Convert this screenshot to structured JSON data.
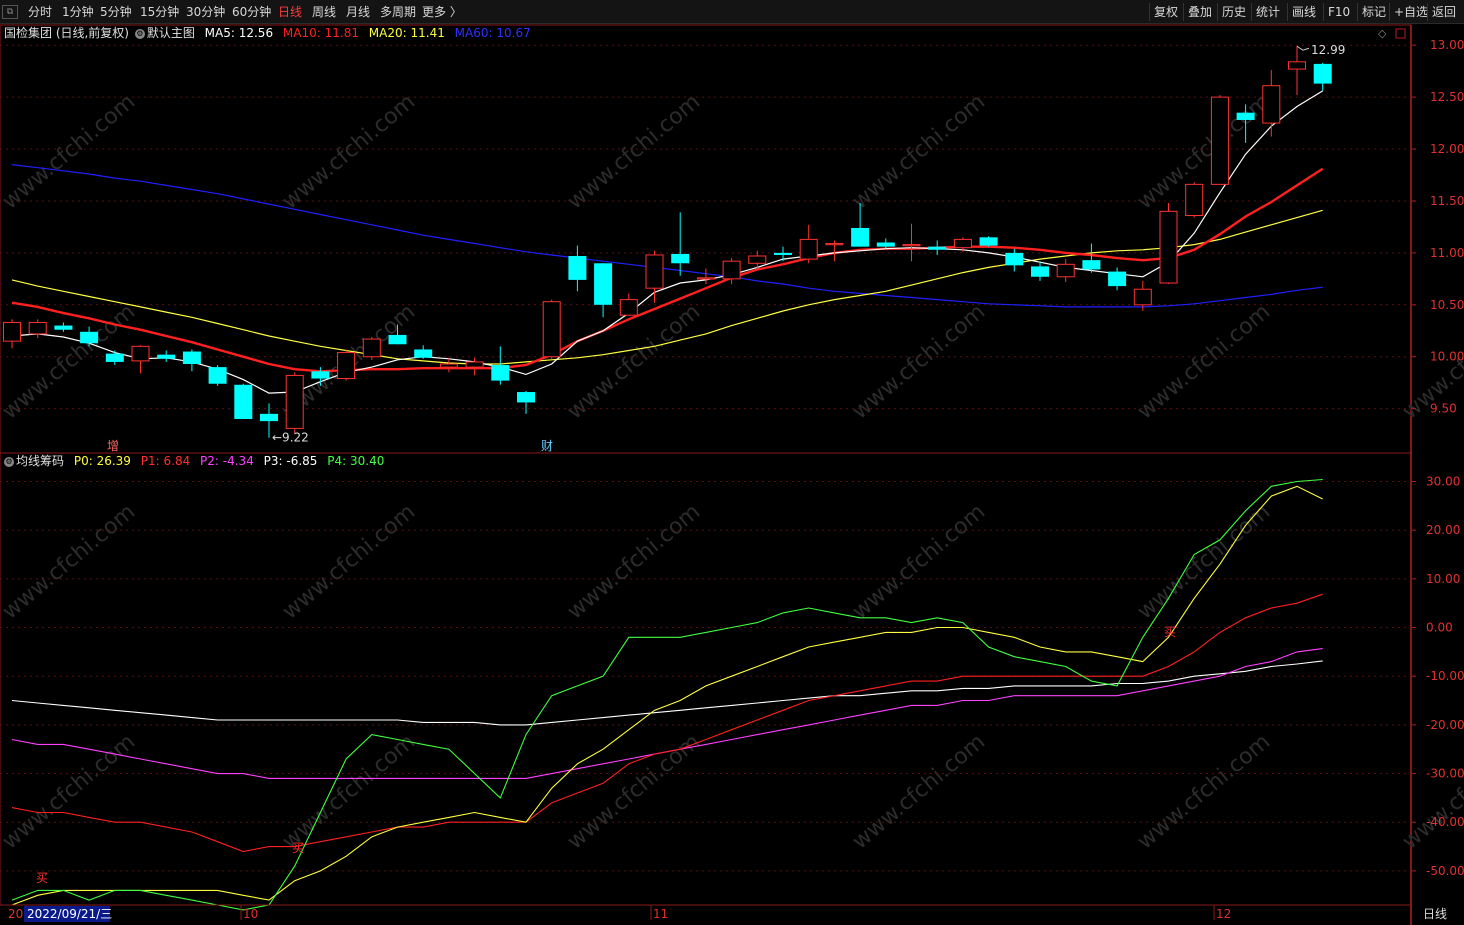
{
  "toolbar": {
    "periods": [
      "分时",
      "1分钟",
      "5分钟",
      "15分钟",
      "30分钟",
      "60分钟",
      "日线",
      "周线",
      "月线",
      "多周期",
      "更多 〉"
    ],
    "active_period": "日线",
    "right": [
      "复权",
      "叠加",
      "历史",
      "统计",
      "画线",
      "F10",
      "标记",
      "+自选",
      "返回"
    ]
  },
  "main_legend": {
    "stock": "国检集团 (日线,前复权)",
    "template": "默认主图",
    "ma5": "MA5: 12.56",
    "ma10": "MA10: 11.81",
    "ma20": "MA20: 11.41",
    "ma60": "MA60: 10.67"
  },
  "indicator_legend": {
    "name": "均线筹码",
    "p0": "P0: 26.39",
    "p1": "P1: 6.84",
    "p2": "P2: -4.34",
    "p3": "P3: -6.85",
    "p4": "P4: 30.40"
  },
  "annotations": {
    "high": "12.99",
    "low": "9.22",
    "mark_zeng": "增",
    "mark_cai": "财",
    "buy": "买"
  },
  "x_axis": {
    "cursor_date": "2022/09/21/三",
    "year_prefix": "20",
    "month_10": "10",
    "month_11": "11",
    "month_12": "12"
  },
  "period_tab": "日线",
  "watermark": "www.cfchi.com",
  "colors": {
    "up": "#ff3232",
    "down": "#00ffff",
    "ma5": "#ffffff",
    "ma10": "#ff2020",
    "ma20": "#ffff40",
    "ma60": "#2020ff",
    "p0": "#ffff40",
    "p1": "#ff2020",
    "p2": "#ff40ff",
    "p3": "#ffffff",
    "p4": "#40ff40"
  },
  "chart_data": [
    {
      "type": "candlestick",
      "title": "国检集团 (日线,前复权)",
      "ylim": [
        9.15,
        13.05
      ],
      "yticks": [
        "13.00",
        "12.50",
        "12.00",
        "11.50",
        "11.00",
        "10.50",
        "10.00",
        "9.50"
      ],
      "candles": [
        {
          "o": 10.15,
          "h": 10.36,
          "l": 10.08,
          "c": 10.33
        },
        {
          "o": 10.22,
          "h": 10.36,
          "l": 10.18,
          "c": 10.33
        },
        {
          "o": 10.3,
          "h": 10.33,
          "l": 10.24,
          "c": 10.26
        },
        {
          "o": 10.24,
          "h": 10.29,
          "l": 10.1,
          "c": 10.13
        },
        {
          "o": 10.03,
          "h": 10.06,
          "l": 9.92,
          "c": 9.95
        },
        {
          "o": 9.96,
          "h": 10.11,
          "l": 9.84,
          "c": 10.1
        },
        {
          "o": 10.02,
          "h": 10.06,
          "l": 9.95,
          "c": 9.98
        },
        {
          "o": 10.05,
          "h": 10.07,
          "l": 9.86,
          "c": 9.93
        },
        {
          "o": 9.9,
          "h": 9.92,
          "l": 9.72,
          "c": 9.74
        },
        {
          "o": 9.73,
          "h": 9.74,
          "l": 9.4,
          "c": 9.4
        },
        {
          "o": 9.45,
          "h": 9.55,
          "l": 9.22,
          "c": 9.38
        },
        {
          "o": 9.31,
          "h": 9.85,
          "l": 9.26,
          "c": 9.82
        },
        {
          "o": 9.86,
          "h": 9.9,
          "l": 9.72,
          "c": 9.79
        },
        {
          "o": 9.79,
          "h": 10.07,
          "l": 9.77,
          "c": 10.04
        },
        {
          "o": 10.0,
          "h": 10.19,
          "l": 9.97,
          "c": 10.17
        },
        {
          "o": 10.21,
          "h": 10.31,
          "l": 10.12,
          "c": 10.12
        },
        {
          "o": 10.07,
          "h": 10.11,
          "l": 9.98,
          "c": 9.99
        },
        {
          "o": 9.9,
          "h": 9.99,
          "l": 9.85,
          "c": 9.93
        },
        {
          "o": 9.9,
          "h": 9.99,
          "l": 9.82,
          "c": 9.95
        },
        {
          "o": 9.92,
          "h": 10.1,
          "l": 9.73,
          "c": 9.77
        },
        {
          "o": 9.66,
          "h": 9.67,
          "l": 9.45,
          "c": 9.56
        },
        {
          "o": 10.0,
          "h": 10.55,
          "l": 9.98,
          "c": 10.53
        },
        {
          "o": 10.97,
          "h": 11.07,
          "l": 10.63,
          "c": 10.74
        },
        {
          "o": 10.9,
          "h": 10.9,
          "l": 10.38,
          "c": 10.5
        },
        {
          "o": 10.4,
          "h": 10.61,
          "l": 10.4,
          "c": 10.55
        },
        {
          "o": 10.66,
          "h": 11.02,
          "l": 10.52,
          "c": 10.98
        },
        {
          "o": 10.99,
          "h": 11.39,
          "l": 10.78,
          "c": 10.9
        },
        {
          "o": 10.75,
          "h": 10.85,
          "l": 10.7,
          "c": 10.76
        },
        {
          "o": 10.75,
          "h": 10.95,
          "l": 10.7,
          "c": 10.92
        },
        {
          "o": 10.9,
          "h": 11.02,
          "l": 10.84,
          "c": 10.97
        },
        {
          "o": 11.0,
          "h": 11.06,
          "l": 10.92,
          "c": 10.98
        },
        {
          "o": 10.94,
          "h": 11.27,
          "l": 10.9,
          "c": 11.13
        },
        {
          "o": 11.08,
          "h": 11.12,
          "l": 10.92,
          "c": 11.09
        },
        {
          "o": 11.24,
          "h": 11.48,
          "l": 11.06,
          "c": 11.06
        },
        {
          "o": 11.1,
          "h": 11.14,
          "l": 11.04,
          "c": 11.06
        },
        {
          "o": 11.07,
          "h": 11.28,
          "l": 10.92,
          "c": 11.08
        },
        {
          "o": 11.06,
          "h": 11.12,
          "l": 10.98,
          "c": 11.03
        },
        {
          "o": 11.05,
          "h": 11.15,
          "l": 11.01,
          "c": 11.13
        },
        {
          "o": 11.15,
          "h": 11.16,
          "l": 11.06,
          "c": 11.07
        },
        {
          "o": 11.0,
          "h": 11.04,
          "l": 10.82,
          "c": 10.88
        },
        {
          "o": 10.87,
          "h": 10.92,
          "l": 10.73,
          "c": 10.77
        },
        {
          "o": 10.77,
          "h": 10.94,
          "l": 10.72,
          "c": 10.89
        },
        {
          "o": 10.93,
          "h": 11.09,
          "l": 10.81,
          "c": 10.84
        },
        {
          "o": 10.82,
          "h": 10.86,
          "l": 10.64,
          "c": 10.68
        },
        {
          "o": 10.5,
          "h": 10.73,
          "l": 10.44,
          "c": 10.65
        },
        {
          "o": 10.71,
          "h": 11.48,
          "l": 10.7,
          "c": 11.4
        },
        {
          "o": 11.36,
          "h": 11.68,
          "l": 11.34,
          "c": 11.66
        },
        {
          "o": 11.66,
          "h": 12.52,
          "l": 11.66,
          "c": 12.5
        },
        {
          "o": 12.35,
          "h": 12.43,
          "l": 12.06,
          "c": 12.28
        },
        {
          "o": 12.25,
          "h": 12.76,
          "l": 12.12,
          "c": 12.61
        },
        {
          "o": 12.77,
          "h": 12.99,
          "l": 12.52,
          "c": 12.84
        },
        {
          "o": 12.82,
          "h": 12.83,
          "l": 12.56,
          "c": 12.63
        }
      ],
      "ma5": [
        10.2,
        10.22,
        10.19,
        10.13,
        10.04,
        9.98,
        9.99,
        9.95,
        9.88,
        9.78,
        9.65,
        9.66,
        9.76,
        9.85,
        9.9,
        9.97,
        10.0,
        9.98,
        9.95,
        9.9,
        9.83,
        9.93,
        10.15,
        10.25,
        10.42,
        10.62,
        10.71,
        10.74,
        10.79,
        10.86,
        10.94,
        10.97,
        11.0,
        11.02,
        11.04,
        11.05,
        11.04,
        11.03,
        11.0,
        10.96,
        10.91,
        10.86,
        10.83,
        10.8,
        10.77,
        10.91,
        11.19,
        11.58,
        11.95,
        12.22,
        12.41,
        12.56
      ],
      "ma10": [
        10.52,
        10.48,
        10.42,
        10.37,
        10.31,
        10.26,
        10.2,
        10.14,
        10.07,
        10.0,
        9.93,
        9.88,
        9.86,
        9.87,
        9.88,
        9.88,
        9.89,
        9.89,
        9.89,
        9.89,
        9.92,
        10.02,
        10.15,
        10.25,
        10.36,
        10.46,
        10.56,
        10.66,
        10.76,
        10.84,
        10.89,
        10.95,
        11.0,
        11.03,
        11.04,
        11.04,
        11.05,
        11.06,
        11.06,
        11.05,
        11.03,
        11.0,
        10.98,
        10.95,
        10.93,
        10.95,
        11.03,
        11.18,
        11.35,
        11.49,
        11.65,
        11.81
      ],
      "ma20": [
        10.74,
        10.68,
        10.63,
        10.58,
        10.53,
        10.48,
        10.43,
        10.38,
        10.32,
        10.26,
        10.2,
        10.15,
        10.1,
        10.06,
        10.02,
        9.98,
        9.96,
        9.94,
        9.93,
        9.93,
        9.95,
        9.97,
        9.99,
        10.02,
        10.06,
        10.1,
        10.16,
        10.22,
        10.3,
        10.37,
        10.44,
        10.5,
        10.55,
        10.59,
        10.63,
        10.69,
        10.75,
        10.81,
        10.86,
        10.9,
        10.94,
        10.97,
        11.0,
        11.02,
        11.03,
        11.05,
        11.08,
        11.13,
        11.2,
        11.27,
        11.34,
        11.41
      ],
      "ma60": [
        11.85,
        11.82,
        11.79,
        11.76,
        11.72,
        11.69,
        11.65,
        11.61,
        11.57,
        11.52,
        11.47,
        11.42,
        11.37,
        11.32,
        11.27,
        11.22,
        11.17,
        11.13,
        11.09,
        11.05,
        11.01,
        10.98,
        10.95,
        10.92,
        10.89,
        10.86,
        10.83,
        10.8,
        10.77,
        10.73,
        10.7,
        10.66,
        10.63,
        10.61,
        10.59,
        10.57,
        10.55,
        10.53,
        10.51,
        10.5,
        10.49,
        10.48,
        10.48,
        10.48,
        10.48,
        10.49,
        10.51,
        10.54,
        10.57,
        10.6,
        10.64,
        10.67
      ]
    },
    {
      "type": "line",
      "title": "均线筹码",
      "ylim": [
        -57,
        34
      ],
      "yticks": [
        "30.00",
        "20.00",
        "10.00",
        "0.00",
        "-10.00",
        "-20.00",
        "-30.00",
        "-40.00",
        "-50.00"
      ],
      "series": [
        {
          "name": "P0",
          "values": [
            -57,
            -55,
            -54,
            -54,
            -54,
            -54,
            -54,
            -54,
            -54,
            -55,
            -56,
            -52,
            -50,
            -47,
            -43,
            -41,
            -40,
            -39,
            -38,
            -39,
            -40,
            -33,
            -28,
            -25,
            -21,
            -17,
            -15,
            -12,
            -10,
            -8,
            -6,
            -4,
            -3,
            -2,
            -1,
            -1,
            0,
            0,
            -1,
            -2,
            -4,
            -5,
            -5,
            -6,
            -7,
            -2,
            6,
            13,
            21,
            27,
            29,
            26.39
          ]
        },
        {
          "name": "P1",
          "values": [
            -37,
            -38,
            -38,
            -39,
            -40,
            -40,
            -41,
            -42,
            -44,
            -46,
            -45,
            -45,
            -44,
            -43,
            -42,
            -41,
            -41,
            -40,
            -40,
            -40,
            -40,
            -36,
            -34,
            -32,
            -28,
            -26,
            -25,
            -23,
            -21,
            -19,
            -17,
            -15,
            -14,
            -13,
            -12,
            -11,
            -11,
            -10,
            -10,
            -10,
            -10,
            -10,
            -10,
            -10,
            -10,
            -8,
            -5,
            -1,
            2,
            4,
            5,
            6.84
          ]
        },
        {
          "name": "P2",
          "values": [
            -23,
            -24,
            -24,
            -25,
            -26,
            -27,
            -28,
            -29,
            -30,
            -30,
            -31,
            -31,
            -31,
            -31,
            -31,
            -31,
            -31,
            -31,
            -31,
            -31,
            -31,
            -30,
            -29,
            -28,
            -27,
            -26,
            -25,
            -24,
            -23,
            -22,
            -21,
            -20,
            -19,
            -18,
            -17,
            -16,
            -16,
            -15,
            -15,
            -14,
            -14,
            -14,
            -14,
            -14,
            -13,
            -12,
            -11,
            -10,
            -8,
            -7,
            -5,
            -4.34
          ]
        },
        {
          "name": "P3",
          "values": [
            -15,
            -15.5,
            -16,
            -16.5,
            -17,
            -17.5,
            -18,
            -18.5,
            -19,
            -19,
            -19,
            -19,
            -19,
            -19,
            -19,
            -19,
            -19.5,
            -19.5,
            -19.5,
            -20,
            -20,
            -19.5,
            -19,
            -18.5,
            -18,
            -17.5,
            -17,
            -16.5,
            -16,
            -15.5,
            -15,
            -14.5,
            -14,
            -14,
            -13.5,
            -13,
            -13,
            -12.5,
            -12.5,
            -12,
            -12,
            -12,
            -12,
            -11.5,
            -11.5,
            -11,
            -10,
            -9.5,
            -9,
            -8,
            -7.5,
            -6.85
          ]
        },
        {
          "name": "P4",
          "values": [
            -56,
            -54,
            -54,
            -56,
            -54,
            -54,
            -55,
            -56,
            -57,
            -58,
            -57,
            -49,
            -38,
            -27,
            -22,
            -23,
            -24,
            -25,
            -30,
            -35,
            -22,
            -14,
            -12,
            -10,
            -2,
            -2,
            -2,
            -1,
            0,
            1,
            3,
            4,
            3,
            2,
            2,
            1,
            2,
            1,
            -4,
            -6,
            -7,
            -8,
            -11,
            -12,
            -2,
            6,
            15,
            18,
            24,
            29,
            30,
            30.4
          ]
        }
      ]
    }
  ]
}
